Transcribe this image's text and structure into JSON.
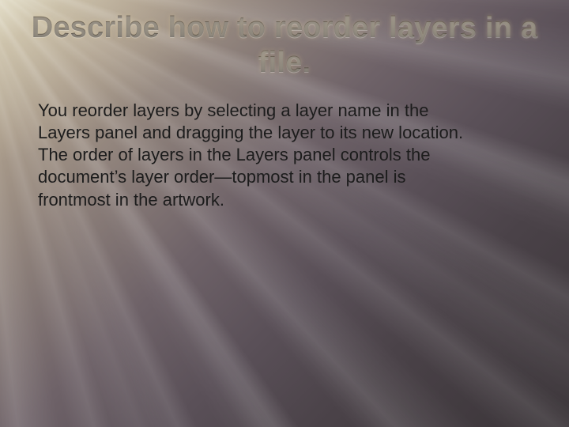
{
  "title": "Describe how to reorder layers in a file.",
  "body": "You reorder layers by selecting a layer name in the Layers panel and dragging the layer to its new location. The order of layers in the Layers panel controls the document’s layer order—topmost in the panel is frontmost in the artwork."
}
